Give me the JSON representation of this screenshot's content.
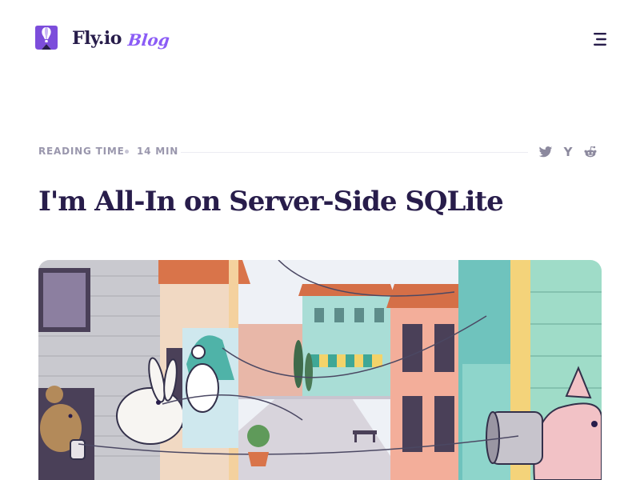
{
  "header": {
    "brand": "Fly.io",
    "section": "Blog",
    "logo_icon": "fly-balloon-icon",
    "menu_icon": "hamburger-menu-icon"
  },
  "article": {
    "reading_time_label": "READING TIME",
    "reading_time_value": "14 MIN",
    "title": "I'm All-In on Server-Side SQLite"
  },
  "share": [
    {
      "name": "twitter",
      "icon": "twitter-icon"
    },
    {
      "name": "hacker-news",
      "icon": "hacker-news-icon",
      "glyph": "Y"
    },
    {
      "name": "reddit",
      "icon": "reddit-icon"
    }
  ],
  "hero": {
    "icon": "street-illustration",
    "colors": {
      "sky": "#e9eef5",
      "brick": "#d9744a",
      "teal": "#6fc3bd",
      "pink": "#f2c2c6",
      "mint": "#9fdcc8",
      "ink": "#33304a"
    }
  },
  "colors": {
    "ink": "#281d4b",
    "accent": "#8b5cf6",
    "muted": "#9a97ad"
  }
}
